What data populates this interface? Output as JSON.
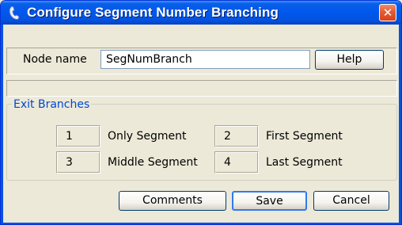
{
  "window": {
    "title": "Configure Segment Number Branching",
    "close_glyph": "✕",
    "title_icon": "phone-handset-icon"
  },
  "node": {
    "label": "Node name",
    "value": "SegNumBranch",
    "help_label": "Help"
  },
  "exit_branches": {
    "title": "Exit Branches",
    "items": [
      {
        "number": "1",
        "label": "Only Segment"
      },
      {
        "number": "2",
        "label": "First Segment"
      },
      {
        "number": "3",
        "label": "Middle Segment"
      },
      {
        "number": "4",
        "label": "Last Segment"
      }
    ]
  },
  "footer": {
    "comments_label": "Comments",
    "save_label": "Save",
    "cancel_label": "Cancel"
  },
  "colors": {
    "titlebar": "#0058ee",
    "close_button": "#e45b33",
    "group_title": "#0046d5",
    "dialog_bg": "#ece9d8"
  }
}
